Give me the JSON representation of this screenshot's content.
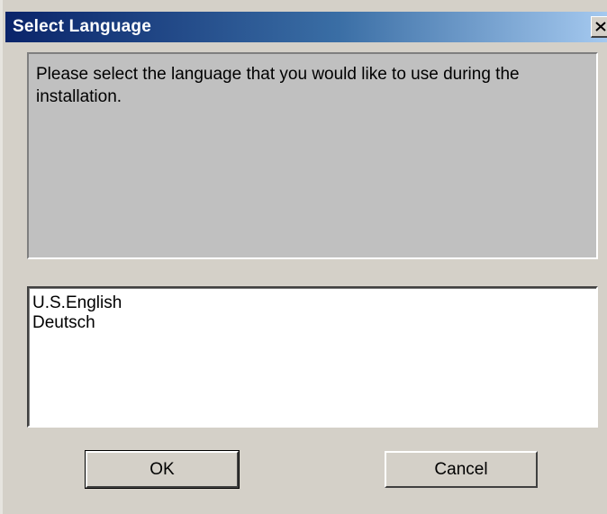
{
  "window": {
    "title": "Select Language",
    "close_icon": "close-x-icon"
  },
  "message": {
    "text": "Please select the language that you would like to use during the installation."
  },
  "language_list": {
    "items": [
      "U.S.English",
      "Deutsch"
    ]
  },
  "buttons": {
    "ok_label": "OK",
    "cancel_label": "Cancel"
  },
  "colors": {
    "titlebar_start": "#0a246a",
    "titlebar_end": "#a6caf0",
    "dialog_background": "#d4d0c8"
  }
}
